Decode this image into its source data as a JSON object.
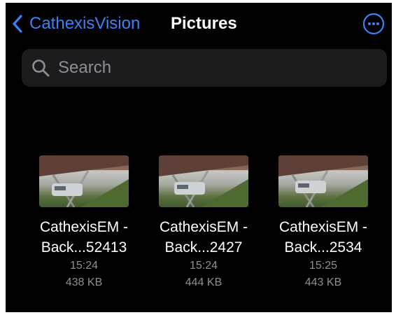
{
  "nav": {
    "back_label": "CathexisVision",
    "title": "Pictures",
    "accent_color": "#3b82f6"
  },
  "search": {
    "placeholder": "Search"
  },
  "files": [
    {
      "line1": "CathexisEM -",
      "line2": "Back...52413",
      "time": "15:24",
      "size": "438 KB"
    },
    {
      "line1": "CathexisEM -",
      "line2": "Back...2427",
      "time": "15:24",
      "size": "444 KB"
    },
    {
      "line1": "CathexisEM -",
      "line2": "Back...2534",
      "time": "15:25",
      "size": "443 KB"
    }
  ],
  "icons": [
    "chevron-left-icon",
    "more-options-icon",
    "search-icon"
  ]
}
